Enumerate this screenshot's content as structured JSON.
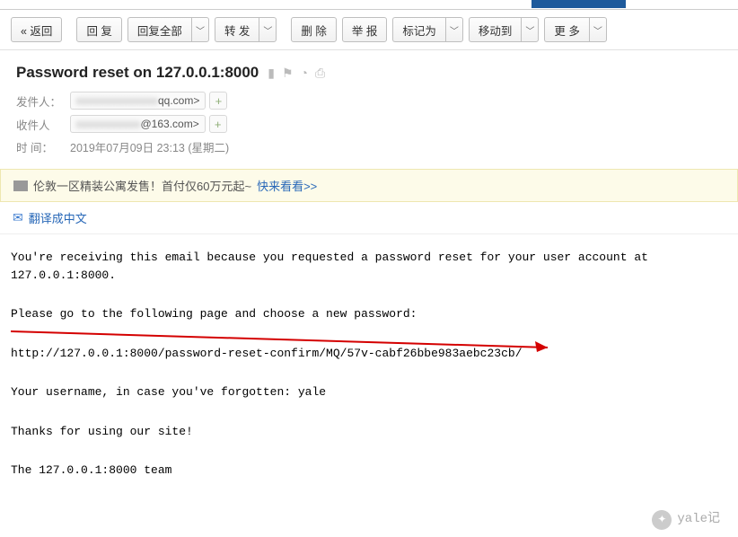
{
  "toolbar": {
    "back": "« 返回",
    "reply": "回 复",
    "reply_all": "回复全部",
    "forward": "转 发",
    "delete": "删 除",
    "report": "举 报",
    "mark_as": "标记为",
    "move_to": "移动到",
    "more": "更 多"
  },
  "subject": "Password reset on 127.0.0.1:8000",
  "meta": {
    "from_label": "发件人：",
    "from_suffix": "qq.com>",
    "to_label": "收件人",
    "to_suffix": "@163.com>",
    "time_label": "时   间：",
    "time_value": "2019年07月09日 23:13 (星期二)"
  },
  "ad": {
    "text": "伦敦一区精装公寓发售！首付仅60万元起~ ",
    "link": "快来看看>>"
  },
  "translate": "翻译成中文",
  "body": {
    "l1": "You're receiving this email because you requested a password reset for your user account at 127.0.0.1:8000.",
    "l2": "Please go to the following page and choose a new password:",
    "l3": "http://127.0.0.1:8000/password-reset-confirm/MQ/57v-cabf26bbe983aebc23cb/",
    "l4": "Your username, in case you've forgotten: yale",
    "l5": "Thanks for using our site!",
    "l6": "The 127.0.0.1:8000 team"
  },
  "watermark": "yale记"
}
